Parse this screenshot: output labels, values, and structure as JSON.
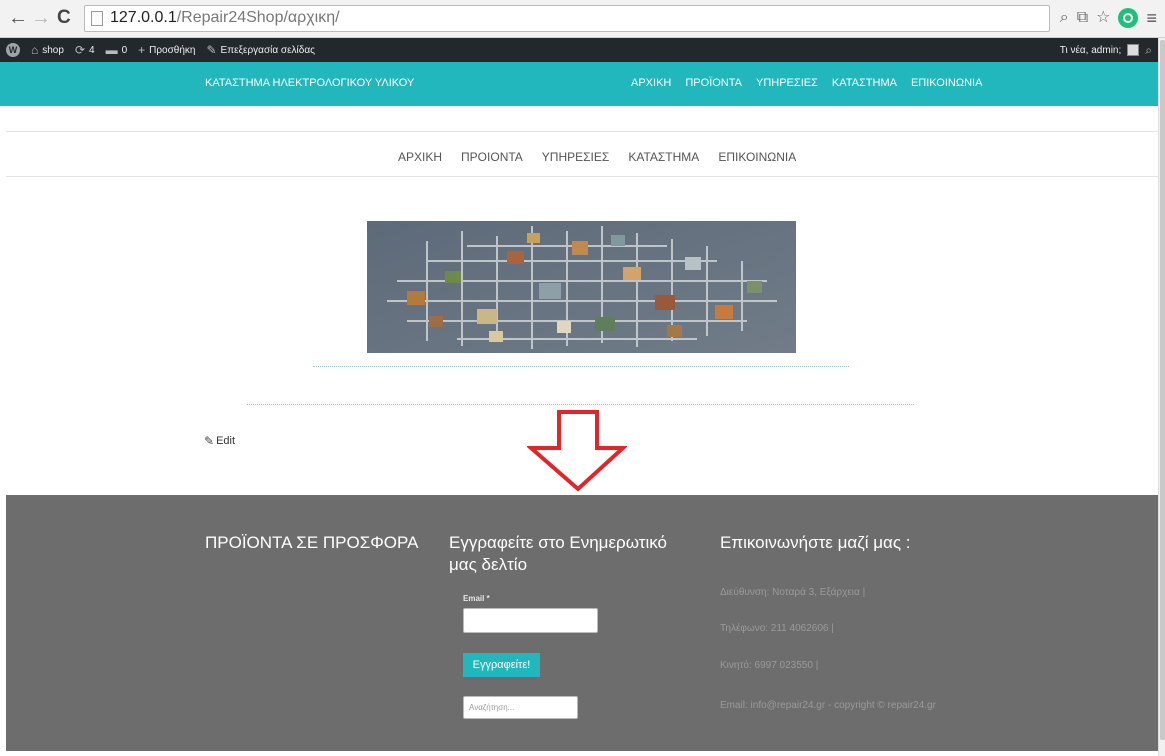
{
  "browser": {
    "url_host": "127.0.0.1",
    "url_path": "/Repair24Shop/αρχικη/"
  },
  "admin_bar": {
    "site": "shop",
    "updates": "4",
    "comments": "0",
    "add_new": "Προσθήκη",
    "edit_page": "Επεξεργασία σελίδας",
    "greeting": "Τι νέα, admin;"
  },
  "header": {
    "site_title": "ΚΑΤΑΣΤΗΜΑ ΗΛΕΚΤΡΟΛΟΓΙΚΟΥ ΥΛΙΚΟΥ",
    "menu": [
      "ΑΡΧΙΚΗ",
      "ΠΡΟΪΟΝΤΑ",
      "ΥΠΗΡΕΣΙΕΣ",
      "ΚΑΤΑΣΤΗΜΑ",
      "ΕΠΙΚΟΙΝΩΝΙΑ"
    ]
  },
  "main_menu": [
    "ΑΡΧΙΚΗ",
    "ΠΡΟΙΟΝΤΑ",
    "ΥΠΗΡΕΣΙΕΣ",
    "ΚΑΤΑΣΤΗΜΑ",
    "ΕΠΙΚΟΙΝΩΝΙΑ"
  ],
  "content": {
    "edit_label": "Edit"
  },
  "footer": {
    "products_heading": "ΠΡΟΪΟΝΤΑ ΣΕ ΠΡΟΣΦΟΡΑ",
    "newsletter_heading": "Εγγραφείτε στο Ενημερωτικό μας δελτίο",
    "email_label": "Email *",
    "subscribe_button": "Εγγραφείτε!",
    "search_placeholder": "Αναζήτηση...",
    "contact_heading": "Επικοινωνήστε μαζί μας :",
    "address": "Διεύθυνση: Νοταρά 3, Εξάρχεια |",
    "phone": "Τηλέφωνο: 211 4062606 |",
    "mobile": "Κινητό: 6997 023550 |",
    "email_copyright": "Email: info@repair24.gr - copyright © repair24.gr"
  },
  "colors": {
    "accent": "#22b6bd",
    "footer_bg": "#6d6d6d",
    "arrow": "#e0262b"
  }
}
